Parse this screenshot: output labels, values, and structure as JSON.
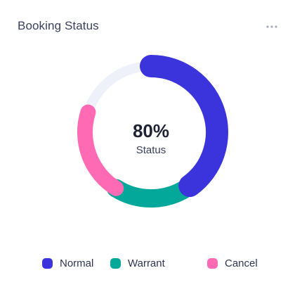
{
  "header": {
    "title": "Booking Status",
    "more_icon": "more-horizontal-icon"
  },
  "colors": {
    "normal": "#3b33dc",
    "warrant": "#04a89a",
    "cancel": "#ff6ab4",
    "track": "#eff1fa"
  },
  "chart_data": {
    "type": "donut",
    "center_value": "80%",
    "center_label": "Status",
    "series": [
      {
        "name": "Normal",
        "value": 40,
        "color": "#3b33dc"
      },
      {
        "name": "Warrant",
        "value": 19,
        "color": "#04a89a"
      },
      {
        "name": "Cancel",
        "value": 21,
        "color": "#ff6ab4"
      }
    ],
    "total": 100,
    "legend": "bottom"
  }
}
